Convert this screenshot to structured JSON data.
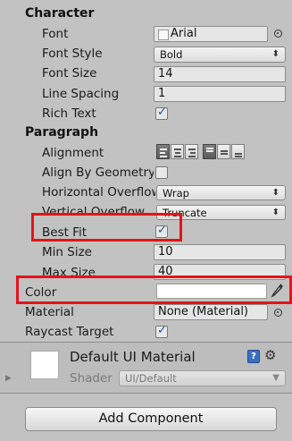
{
  "sections": {
    "character": "Character",
    "paragraph": "Paragraph"
  },
  "character": {
    "font": {
      "label": "Font",
      "value": "Arial"
    },
    "font_style": {
      "label": "Font Style",
      "value": "Bold"
    },
    "font_size": {
      "label": "Font Size",
      "value": "14"
    },
    "line_spacing": {
      "label": "Line Spacing",
      "value": "1"
    },
    "rich_text": {
      "label": "Rich Text",
      "checked": true
    }
  },
  "paragraph": {
    "alignment": {
      "label": "Alignment"
    },
    "align_by_geometry": {
      "label": "Align By Geometry",
      "checked": false
    },
    "horizontal_overflow": {
      "label": "Horizontal Overflow",
      "value": "Wrap"
    },
    "vertical_overflow": {
      "label": "Vertical Overflow",
      "value": "Truncate"
    },
    "best_fit": {
      "label": "Best Fit",
      "checked": true
    },
    "min_size": {
      "label": "Min Size",
      "value": "10"
    },
    "max_size": {
      "label": "Max Size",
      "value": "40"
    }
  },
  "color": {
    "label": "Color",
    "swatch": "#ffffff"
  },
  "material": {
    "label": "Material",
    "value": "None (Material)"
  },
  "raycast_target": {
    "label": "Raycast Target",
    "checked": true
  },
  "material_preview": {
    "name": "Default UI Material",
    "shader_label": "Shader",
    "shader_value": "UI/Default"
  },
  "add_component": {
    "label": "Add Component"
  },
  "icons": {
    "object_picker": "circle-target-icon",
    "eyedropper": "eyedropper-icon",
    "help": "help-book-icon",
    "gear": "gear-icon",
    "foldout": "foldout-arrow-icon",
    "font_asset": "font-asset-icon"
  },
  "colors": {
    "highlight": "#e4131c",
    "check": "#1e4d9a",
    "panel": "#c2c2c2"
  }
}
